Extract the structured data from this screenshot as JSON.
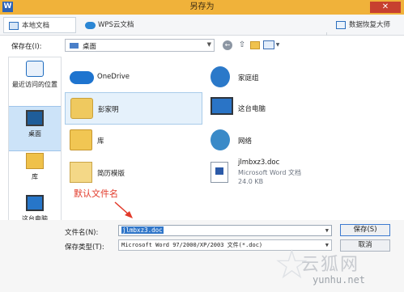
{
  "window": {
    "logo": "W",
    "title": "另存为",
    "close": "✕"
  },
  "tabs": {
    "local": "本地文档",
    "cloud": "WPS云文档",
    "recover": "数据恢复大师"
  },
  "savein": {
    "label": "保存在(I):",
    "value": "桌面"
  },
  "places": {
    "recent": "最近访问的位置",
    "desktop": "桌面",
    "library": "库",
    "thispc": "这台电脑"
  },
  "items": {
    "onedrive": "OneDrive",
    "homegroup": "家庭组",
    "user": "彭家明",
    "thispc": "这台电脑",
    "library": "库",
    "network": "网络",
    "template": "简历模版",
    "doc_name": "jlmbxz3.doc",
    "doc_type": "Microsoft Word 文档",
    "doc_size": "24.0 KB"
  },
  "annotation": {
    "label": "默认文件名"
  },
  "form": {
    "filename_label": "文件名(N):",
    "filename_value": "jlmbxz3.doc",
    "filetype_label": "保存类型(T):",
    "filetype_value": "Microsoft Word 97/2000/XP/2003 文件(*.doc)",
    "save_button": "保存(S)",
    "cancel_button": "取消"
  },
  "watermark": {
    "text": "云狐网",
    "url": "yunhu.net"
  },
  "colors": {
    "title_bar": "#f0b23a",
    "selection": "#cce3f8",
    "annotation": "#e23a2a",
    "accent": "#3076c9"
  }
}
